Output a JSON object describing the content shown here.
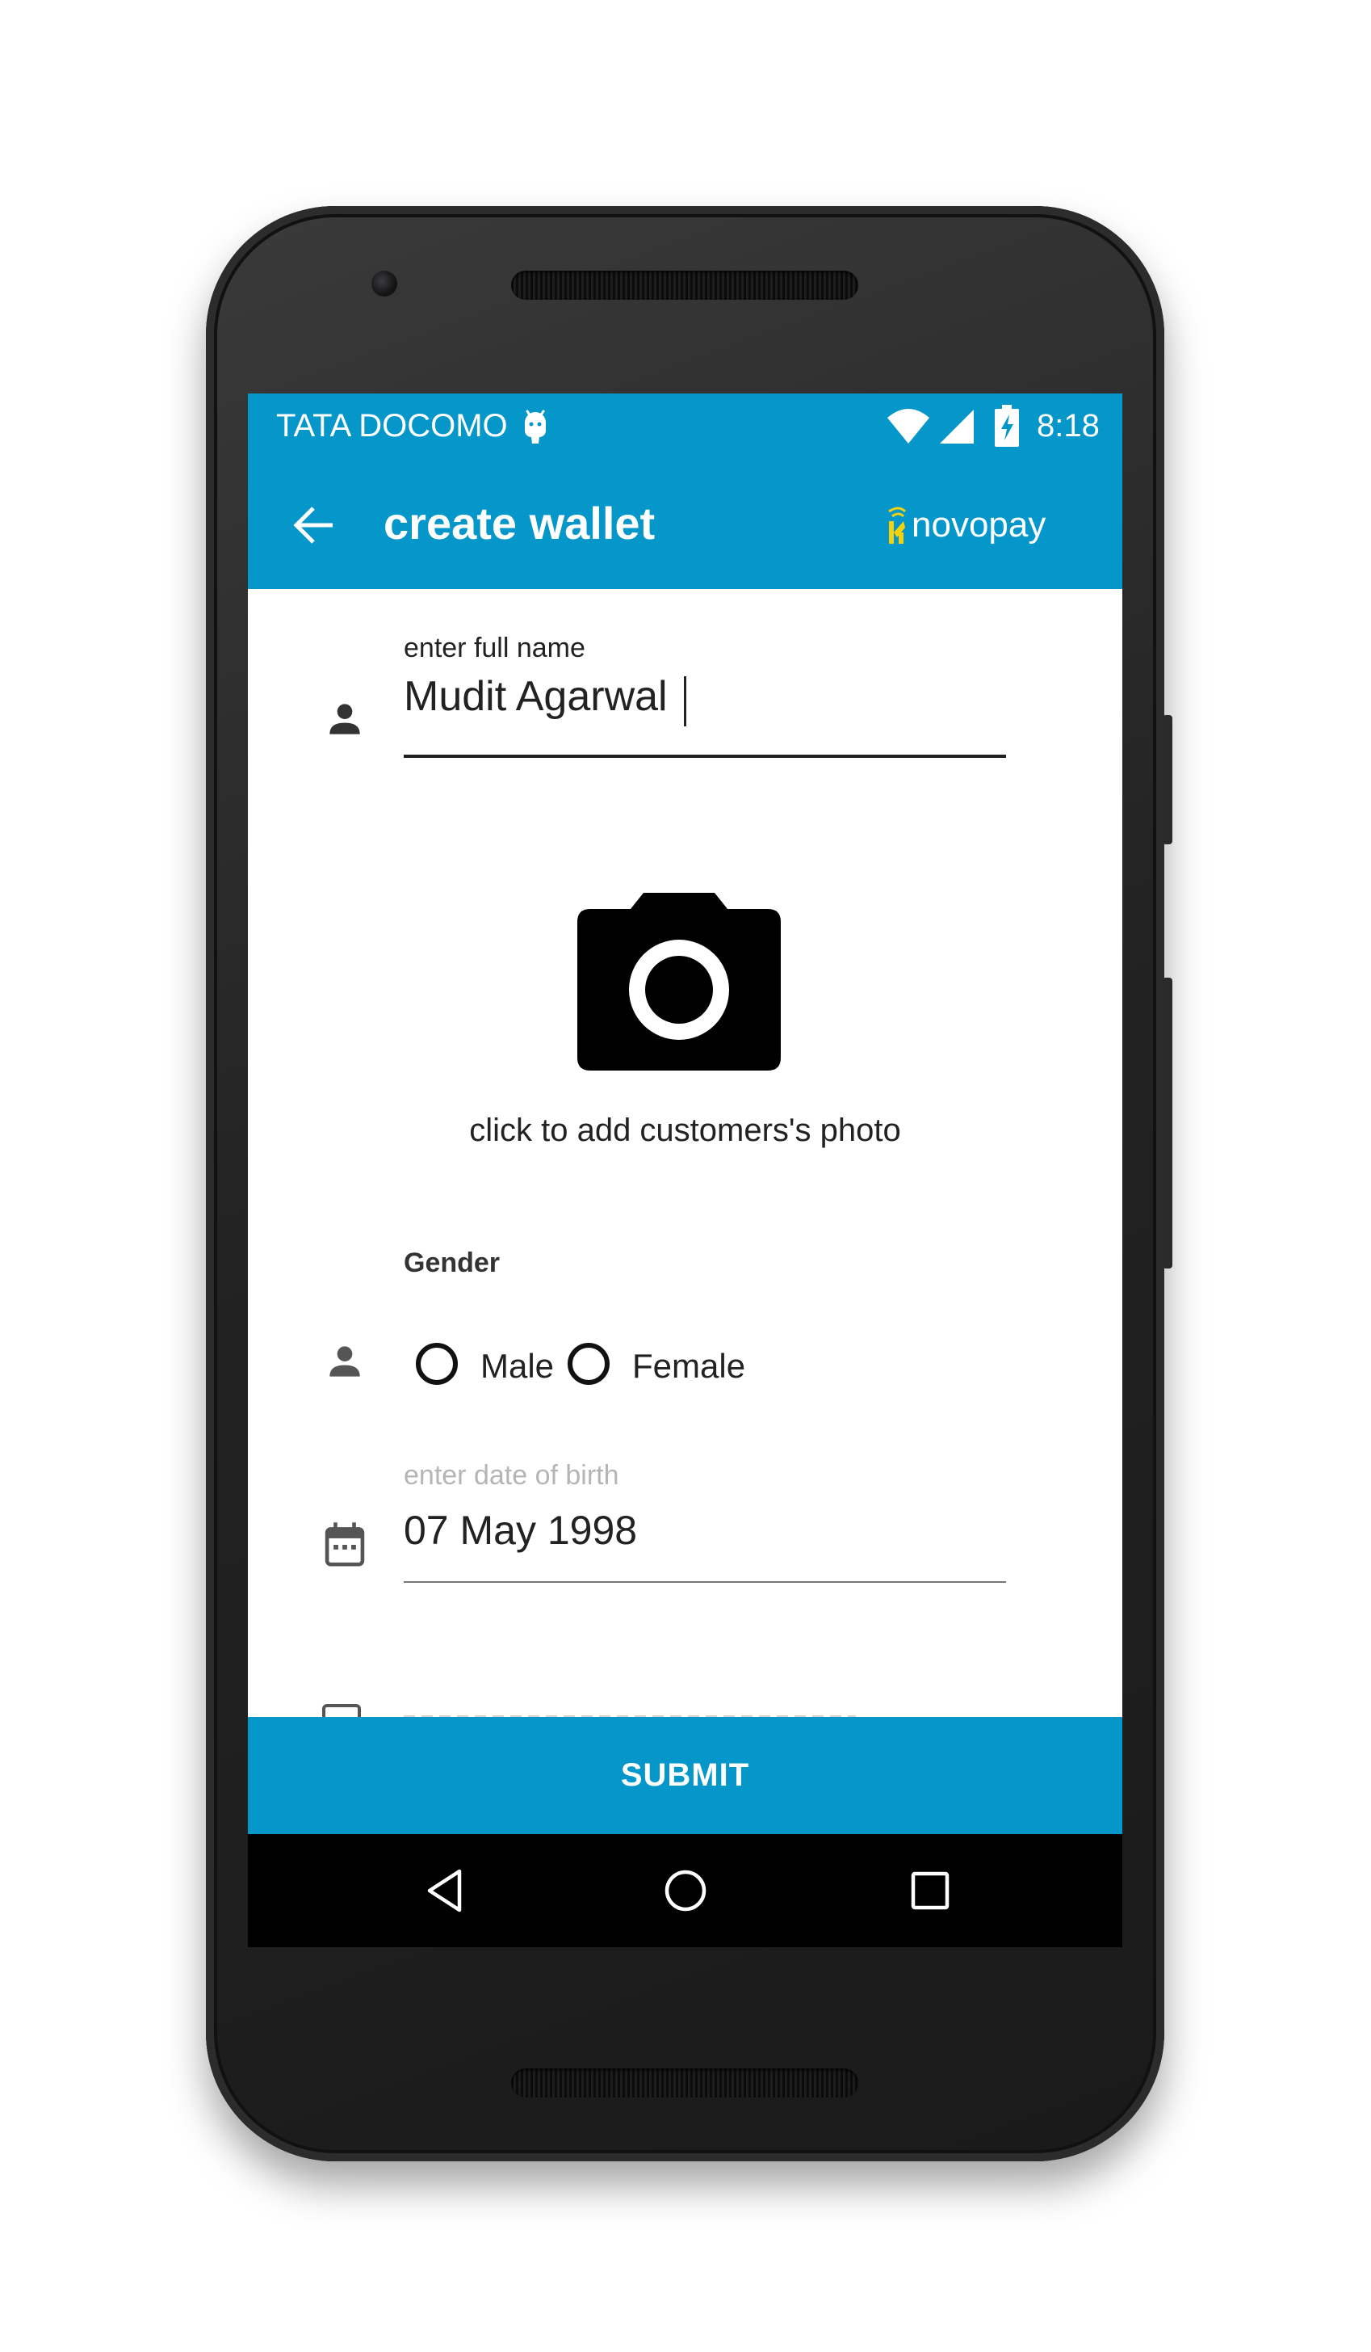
{
  "status_bar": {
    "carrier": "TATA DOCOMO",
    "time": "8:18"
  },
  "app_bar": {
    "title": "create wallet",
    "brand": "novopay"
  },
  "form": {
    "name_label": "enter full name",
    "name_value": "Mudit Agarwal",
    "photo_caption": "click to add customers's photo",
    "gender_label": "Gender",
    "gender_options": [
      "Male",
      "Female"
    ],
    "dob_label": "enter date of birth",
    "dob_value": "07 May 1998"
  },
  "actions": {
    "submit_label": "SUBMIT"
  },
  "colors": {
    "primary": "#0597c9",
    "brand_accent": "#f5d20a",
    "text": "#222222",
    "hint": "#b5b5b5"
  },
  "icons": [
    "back-arrow-icon",
    "android-icon",
    "wifi-icon",
    "signal-icon",
    "battery-charging-icon",
    "person-icon",
    "camera-icon",
    "calendar-icon",
    "nav-back-icon",
    "nav-home-icon",
    "nav-recents-icon"
  ]
}
